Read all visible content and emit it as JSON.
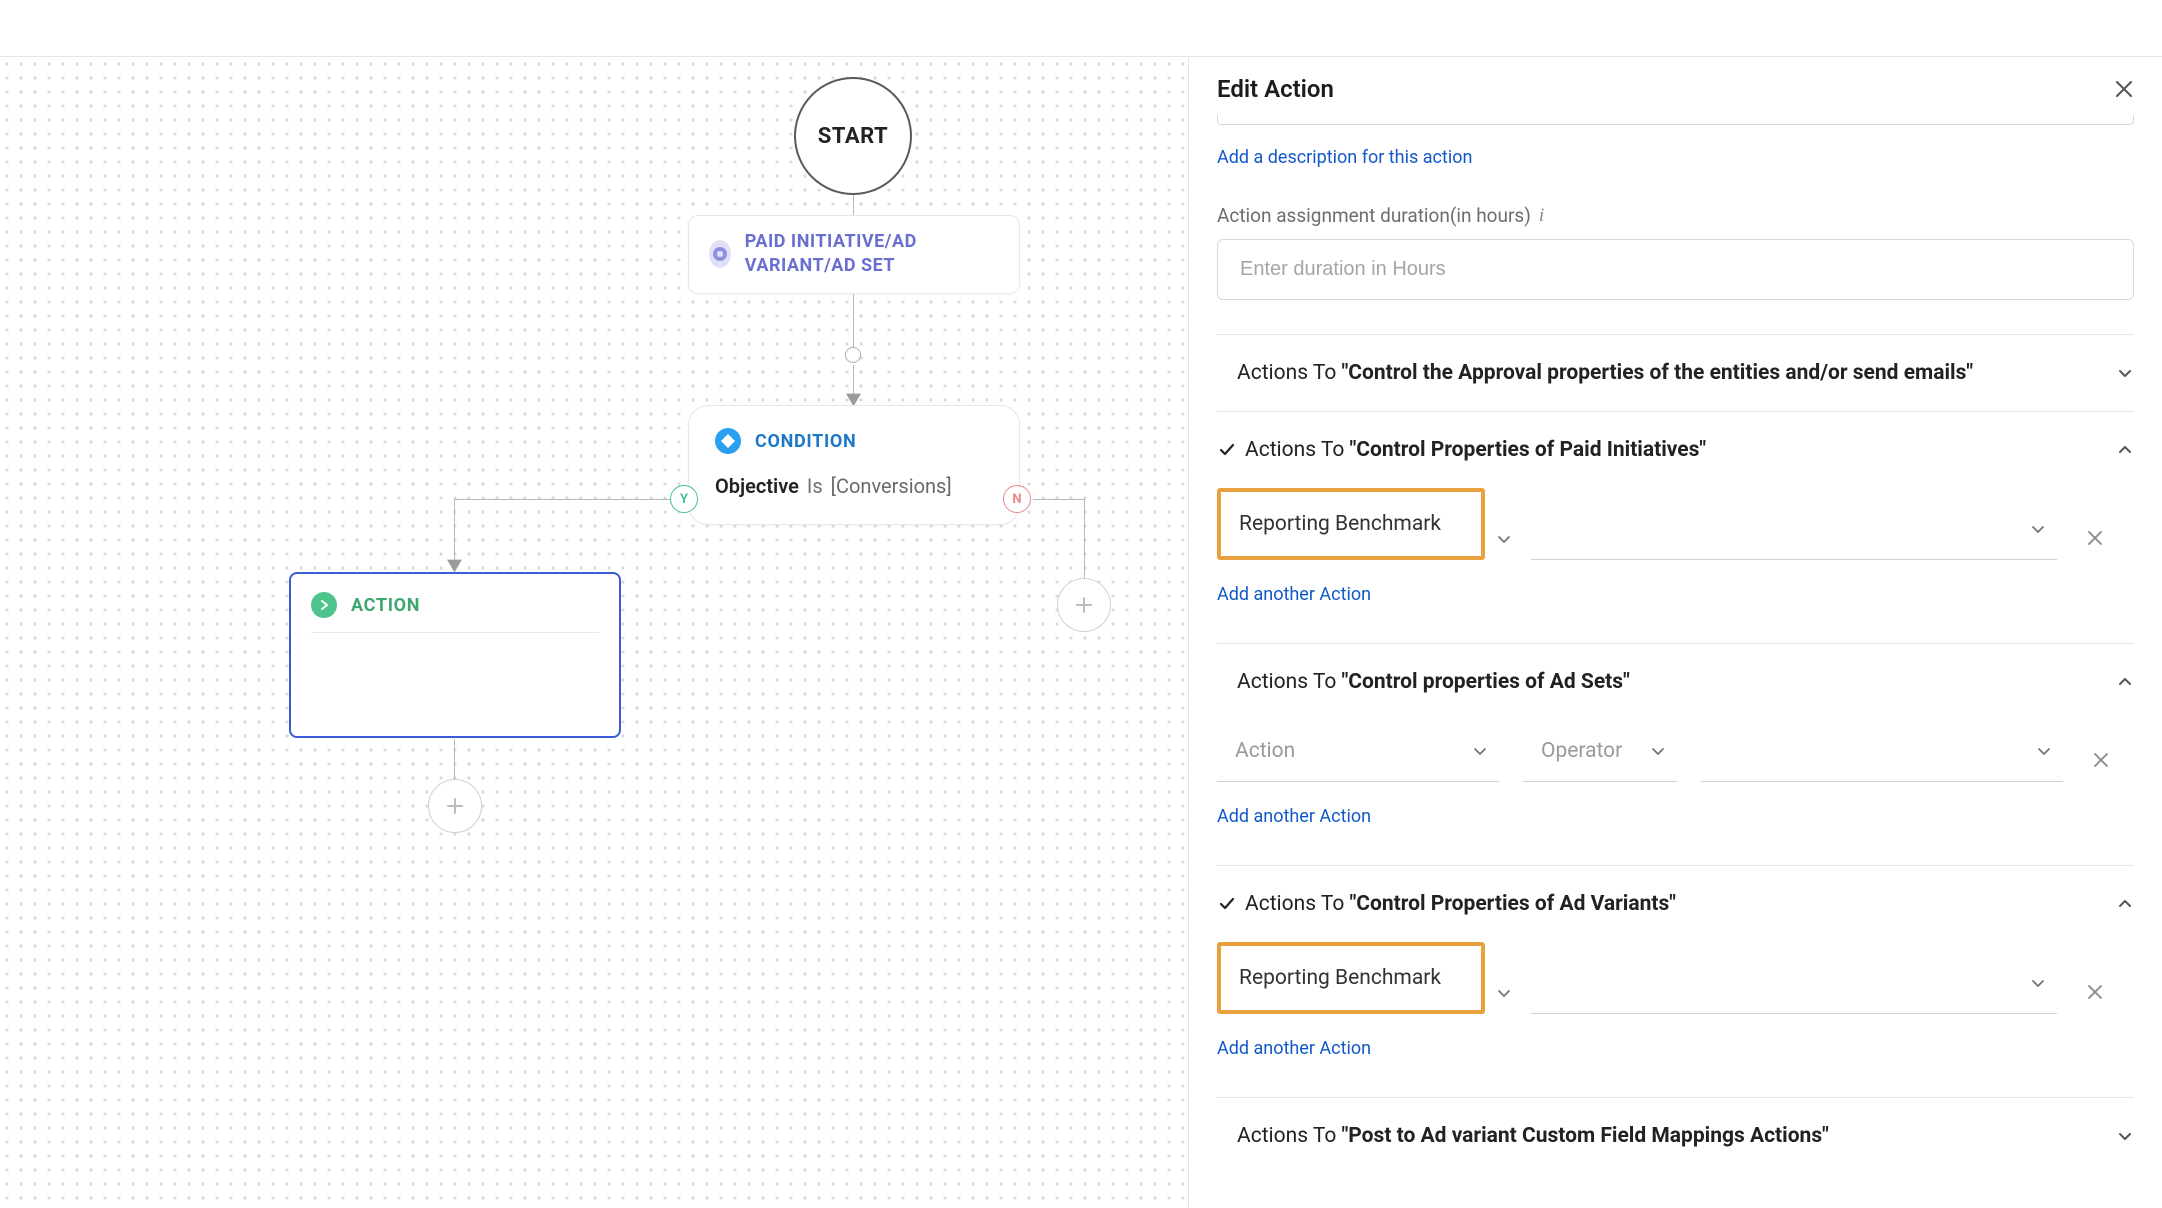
{
  "flow": {
    "start_label": "START",
    "entity_label": "PAID INITIATIVE/AD VARIANT/AD SET",
    "condition_label": "CONDITION",
    "condition_attr": "Objective",
    "condition_op": "Is",
    "condition_value": "[Conversions]",
    "yes_badge": "Y",
    "no_badge": "N",
    "action_label": "ACTION"
  },
  "panel": {
    "title": "Edit Action",
    "add_description_link": "Add a description for this action",
    "duration_label": "Action assignment duration(in hours)",
    "duration_placeholder": "Enter duration in Hours",
    "actions_to_prefix": "Actions To ",
    "add_another_action": "Add another Action",
    "dd_action_placeholder": "Action",
    "dd_operator_placeholder": "Operator",
    "sections": [
      {
        "key": "approval",
        "title_bold": "\"Control the Approval properties of the entities and/or send emails\"",
        "expanded": false,
        "checked": false
      },
      {
        "key": "paid",
        "title_bold": "\"Control Properties of Paid Initiatives\"",
        "expanded": true,
        "checked": true,
        "rows": [
          {
            "action": "Reporting Benchmark",
            "highlighted": true
          }
        ]
      },
      {
        "key": "adsets",
        "title_bold": "\"Control properties of Ad Sets\"",
        "expanded": true,
        "checked": false,
        "rows": [
          {
            "action": "",
            "highlighted": false
          }
        ]
      },
      {
        "key": "advariants",
        "title_bold": "\"Control Properties of Ad Variants\"",
        "expanded": true,
        "checked": true,
        "rows": [
          {
            "action": "Reporting Benchmark",
            "highlighted": true
          }
        ]
      },
      {
        "key": "post",
        "title_bold": "\"Post to Ad variant Custom Field Mappings Actions\"",
        "expanded": false,
        "checked": false
      }
    ]
  }
}
